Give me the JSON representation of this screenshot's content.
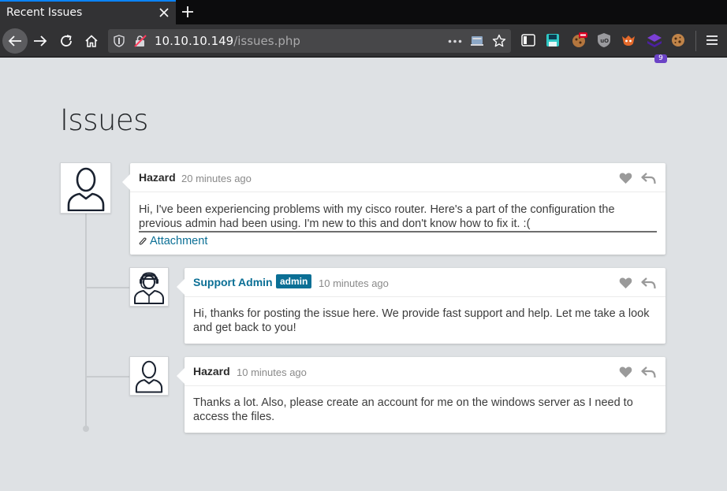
{
  "browser": {
    "tab_title": "Recent Issues",
    "url_host": "10.10.10.149",
    "url_path": "/issues.php",
    "ext_badge_count": "9"
  },
  "page": {
    "title": "Issues"
  },
  "posts": [
    {
      "author": "Hazard",
      "time": "20 minutes ago",
      "text": "Hi, I've been experiencing problems with my cisco router. Here's a part of the configuration the previous admin had been using. I'm new to this and don't know how to fix it. :(",
      "attachment_label": "Attachment",
      "avatar_icon": "user-outline-icon"
    },
    {
      "author": "Support Admin",
      "role": "admin",
      "time": "10 minutes ago",
      "text": "Hi, thanks for posting the issue here. We provide fast support and help. Let me take a look and get back to you!",
      "avatar_icon": "support-agent-icon"
    },
    {
      "author": "Hazard",
      "time": "10 minutes ago",
      "text": "Thanks a lot. Also, please create an account for me on the windows server as I need to access the files.",
      "avatar_icon": "user-outline-icon"
    }
  ],
  "colors": {
    "page_bg": "#dee1e4",
    "accent": "#0b6f95",
    "browser_chrome": "#323234"
  }
}
